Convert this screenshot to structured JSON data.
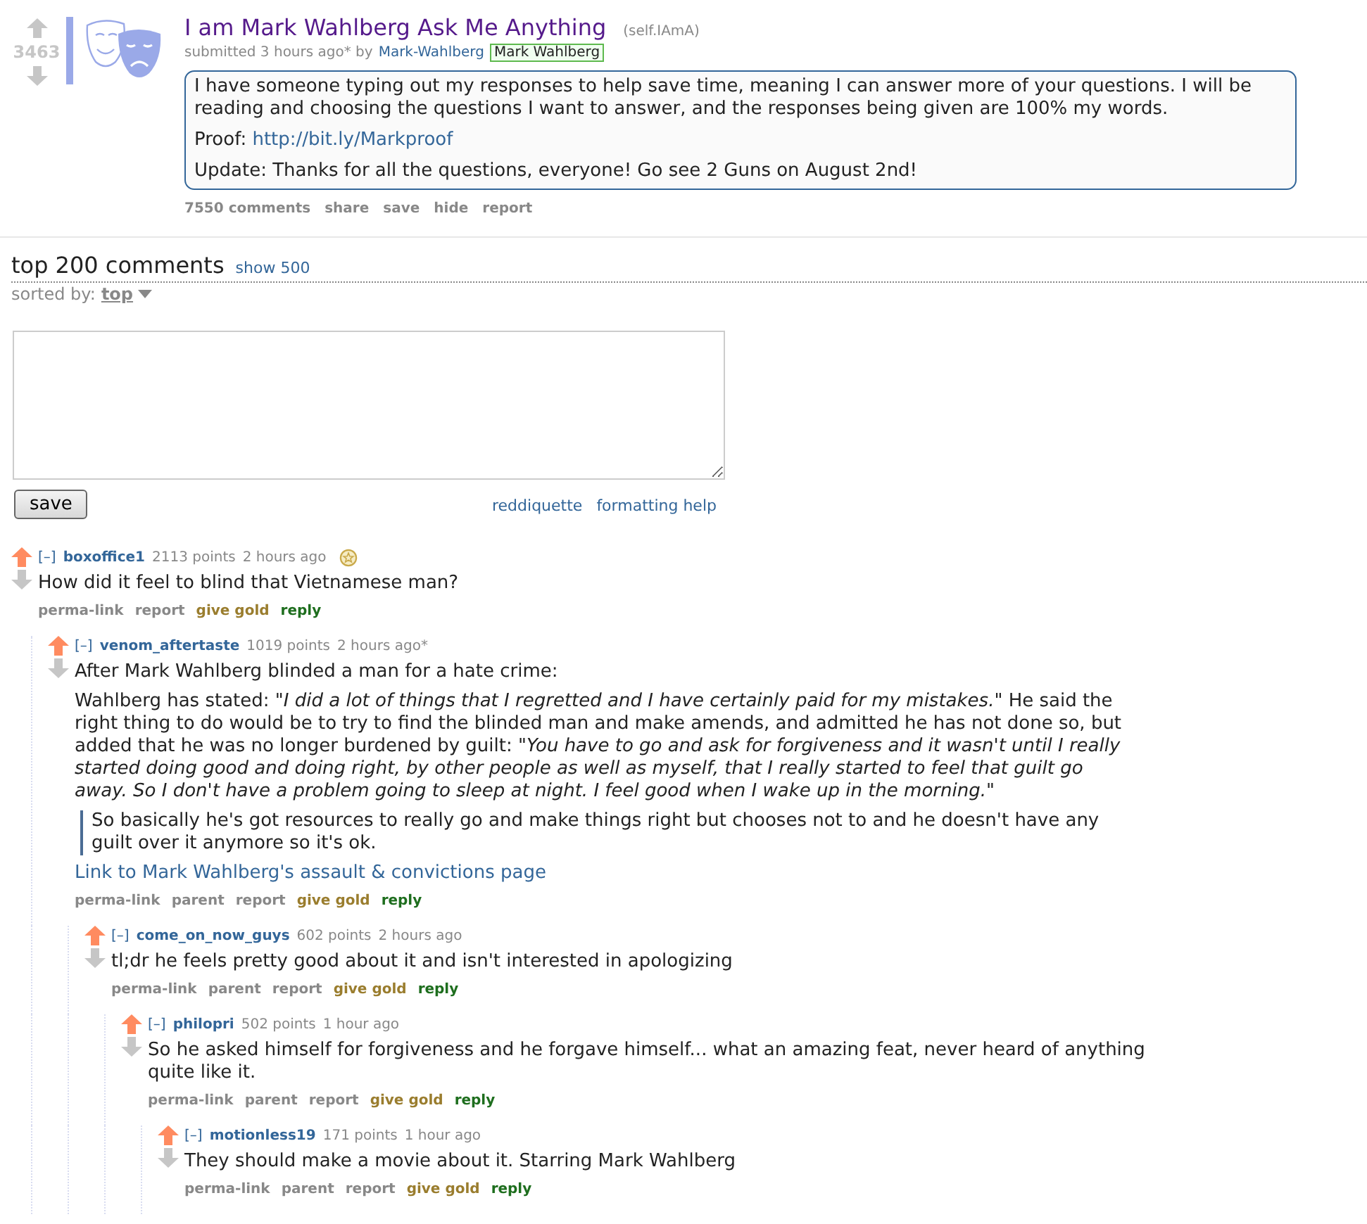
{
  "post": {
    "score": "3463",
    "upvoted": false,
    "title": "I am Mark Wahlberg Ask Me Anything",
    "domain": "(self.IAmA)",
    "submitted": "submitted 3 hours ago* by",
    "author": "Mark-Wahlberg",
    "flair": "Mark Wahlberg",
    "body": [
      {
        "kind": "text",
        "text": "I have someone typing out my responses to help save time, meaning I can answer more of your questions. I will be reading and choosing the questions I want to answer, and the responses being given are 100% my words."
      },
      {
        "kind": "link",
        "text": "Proof:",
        "link": "http://bit.ly/Markproof"
      },
      {
        "kind": "text",
        "text": "Update: Thanks for all the questions, everyone! Go see 2 Guns on August 2nd!"
      }
    ],
    "actions": [
      "7550 comments",
      "share",
      "save",
      "hide",
      "report"
    ]
  },
  "comments_header": {
    "title": "top 200 comments",
    "show_more": "show 500",
    "sort_label": "sorted by:",
    "sort_value": "top"
  },
  "reply_form": {
    "save": "save",
    "links": [
      "reddiquette",
      "formatting help"
    ]
  },
  "comments": [
    {
      "toggle": "[–]",
      "author": "boxoffice1",
      "score": "2113 points",
      "time": "2 hours ago",
      "upvoted": true,
      "gilded": true,
      "body": [
        {
          "kind": "text",
          "text": "How did it feel to blind that Vietnamese man?"
        }
      ],
      "actions": [
        {
          "label": "perma-link",
          "kind": "plain"
        },
        {
          "label": "report",
          "kind": "plain"
        },
        {
          "label": "give gold",
          "kind": "gold"
        },
        {
          "label": "reply",
          "kind": "reply"
        }
      ],
      "children": [
        {
          "toggle": "[–]",
          "author": "venom_aftertaste",
          "score": "1019 points",
          "time": "2 hours ago*",
          "upvoted": true,
          "gilded": false,
          "body": [
            {
              "kind": "text",
              "text": "After Mark Wahlberg blinded a man for a hate crime:"
            },
            {
              "kind": "text",
              "text": "Wahlberg has stated: \"*I did a lot of things that I regretted and I have certainly paid for my mistakes.*\" He said the right thing to do would be to try to find the blinded man and make amends, and admitted he has not done so, but added that he was no longer burdened by guilt: \"*You have to go and ask for forgiveness and it wasn't until I really started doing good and doing right, by other people as well as myself, that I really started to feel that guilt go away. So I don't have a problem going to sleep at night. I feel good when I wake up in the morning.*\""
            },
            {
              "kind": "quote",
              "text": "So basically he's got resources to really go and make things right but chooses not to and he doesn't have any guilt over it anymore so it's ok."
            },
            {
              "kind": "link",
              "text": "Link to Mark Wahlberg's assault & convictions page"
            }
          ],
          "actions": [
            {
              "label": "perma-link",
              "kind": "plain"
            },
            {
              "label": "parent",
              "kind": "plain"
            },
            {
              "label": "report",
              "kind": "plain"
            },
            {
              "label": "give gold",
              "kind": "gold"
            },
            {
              "label": "reply",
              "kind": "reply"
            }
          ],
          "children": [
            {
              "toggle": "[–]",
              "author": "come_on_now_guys",
              "score": "602 points",
              "time": "2 hours ago",
              "upvoted": true,
              "gilded": false,
              "body": [
                {
                  "kind": "text",
                  "text": "tl;dr he feels pretty good about it and isn't interested in apologizing"
                }
              ],
              "actions": [
                {
                  "label": "perma-link",
                  "kind": "plain"
                },
                {
                  "label": "parent",
                  "kind": "plain"
                },
                {
                  "label": "report",
                  "kind": "plain"
                },
                {
                  "label": "give gold",
                  "kind": "gold"
                },
                {
                  "label": "reply",
                  "kind": "reply"
                }
              ],
              "children": [
                {
                  "toggle": "[–]",
                  "author": "philopri",
                  "score": "502 points",
                  "time": "1 hour ago",
                  "upvoted": true,
                  "gilded": false,
                  "body": [
                    {
                      "kind": "text",
                      "text": "So he asked himself for forgiveness and he forgave himself... what an amazing feat, never heard of anything quite like it."
                    }
                  ],
                  "actions": [
                    {
                      "label": "perma-link",
                      "kind": "plain"
                    },
                    {
                      "label": "parent",
                      "kind": "plain"
                    },
                    {
                      "label": "report",
                      "kind": "plain"
                    },
                    {
                      "label": "give gold",
                      "kind": "gold"
                    },
                    {
                      "label": "reply",
                      "kind": "reply"
                    }
                  ],
                  "children": [
                    {
                      "toggle": "[–]",
                      "author": "motionless19",
                      "score": "171 points",
                      "time": "1 hour ago",
                      "upvoted": true,
                      "gilded": false,
                      "body": [
                        {
                          "kind": "text",
                          "text": "They should make a movie about it. Starring Mark Wahlberg"
                        }
                      ],
                      "actions": [
                        {
                          "label": "perma-link",
                          "kind": "plain"
                        },
                        {
                          "label": "parent",
                          "kind": "plain"
                        },
                        {
                          "label": "report",
                          "kind": "plain"
                        },
                        {
                          "label": "give gold",
                          "kind": "gold"
                        },
                        {
                          "label": "reply",
                          "kind": "reply"
                        }
                      ]
                    }
                  ]
                }
              ]
            }
          ]
        }
      ]
    }
  ]
}
